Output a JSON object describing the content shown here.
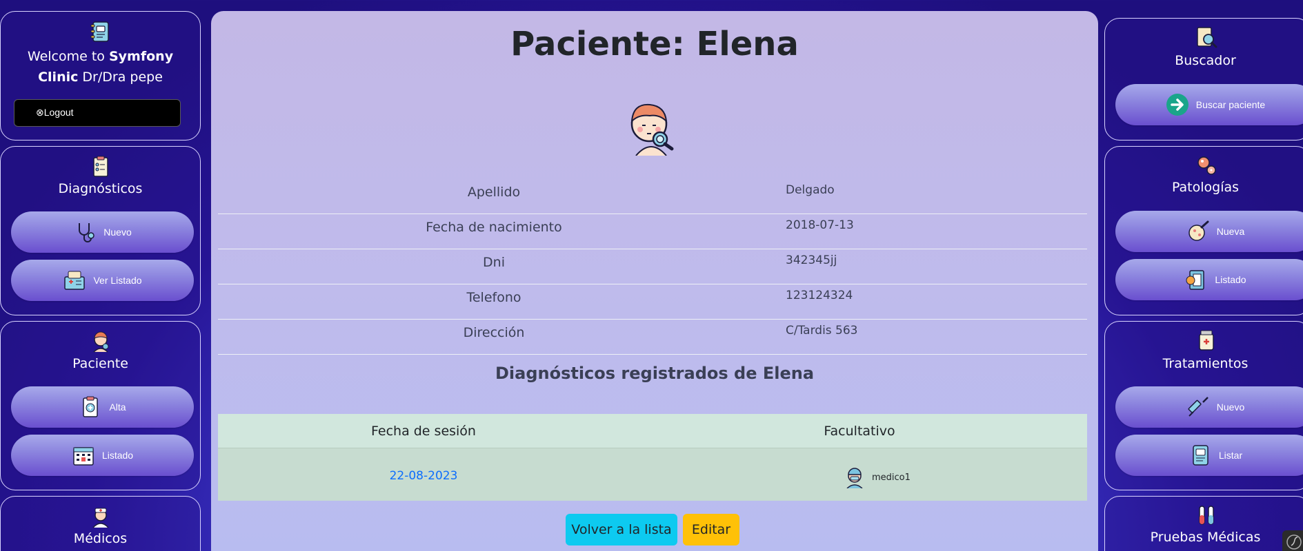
{
  "left": {
    "welcome": {
      "prefix": "Welcome to ",
      "brand": "Symfony Clinic",
      "suffix": " Dr/Dra pepe"
    },
    "logout_label": "⊗Logout",
    "diagnosticos": {
      "title": "Diagnósticos",
      "btn_new": "Nuevo",
      "btn_list": "Ver Listado"
    },
    "paciente": {
      "title": "Paciente",
      "btn_new": "Alta",
      "btn_list": "Listado"
    },
    "medicos": {
      "title": "Médicos"
    }
  },
  "right": {
    "buscador": {
      "title": "Buscador",
      "btn": "Buscar paciente"
    },
    "patologias": {
      "title": "Patologías",
      "btn_new": "Nueva",
      "btn_list": "Listado"
    },
    "tratamientos": {
      "title": "Tratamientos",
      "btn_new": "Nuevo",
      "btn_list": "Listar"
    },
    "pruebas": {
      "title": "Pruebas Médicas"
    }
  },
  "main": {
    "title": "Paciente: Elena",
    "info": [
      {
        "label": "Apellido",
        "value": "Delgado"
      },
      {
        "label": "Fecha de nacimiento",
        "value": "2018-07-13"
      },
      {
        "label": "Dni",
        "value": "342345jj"
      },
      {
        "label": "Telefono",
        "value": "123124324"
      },
      {
        "label": "Dirección",
        "value": "C/Tardis 563"
      }
    ],
    "diag_title": "Diagnósticos registrados de Elena",
    "table": {
      "headers": [
        "Fecha de sesión",
        "Facultativo"
      ],
      "rows": [
        {
          "date": "22-08-2023",
          "doctor": "medico1"
        }
      ]
    },
    "btn_back": "Volver a la lista",
    "btn_edit": "Editar"
  },
  "colors": {
    "back_button": "#0dcaf0",
    "edit_button": "#ffc107",
    "link": "#0d6efd"
  }
}
